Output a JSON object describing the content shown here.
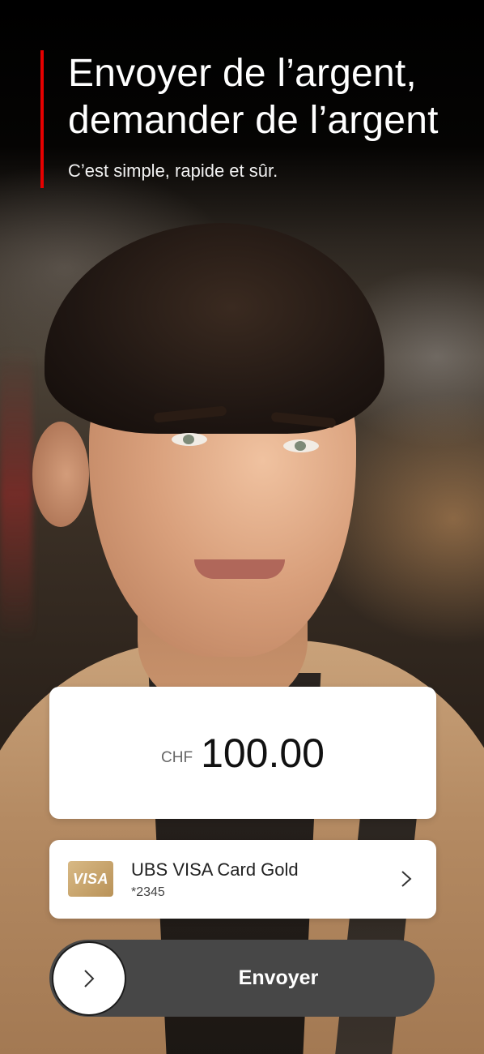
{
  "header": {
    "title_line1": "Envoyer de l’argent,",
    "title_line2": "demander de l’argent",
    "subtitle": "C’est simple, rapide et sûr.",
    "accent_color": "#e60000"
  },
  "amount": {
    "currency": "CHF",
    "value": "100.00"
  },
  "card": {
    "brand_logo": "VISA",
    "name": "UBS VISA Card Gold",
    "number": "*2345",
    "icon": "chevron-right-icon"
  },
  "send": {
    "label": "Envoyer",
    "knob_icon": "chevron-right-icon"
  }
}
